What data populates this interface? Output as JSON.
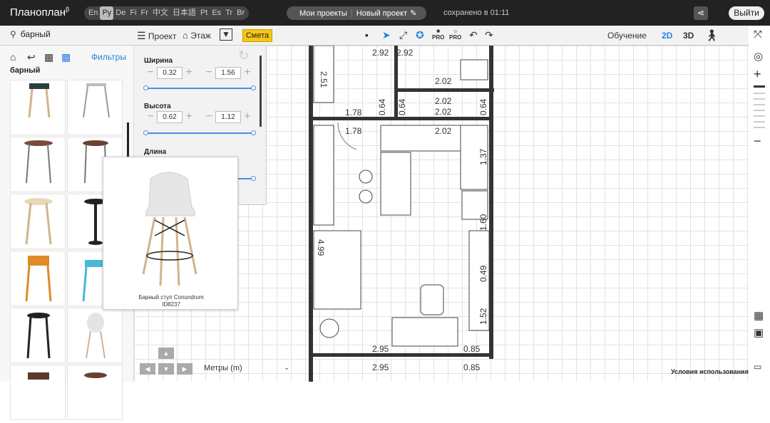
{
  "app": {
    "logo": "Планоплан",
    "logo_sup": "β"
  },
  "languages": [
    "En",
    "Ру",
    "De",
    "Fi",
    "Fr",
    "中文",
    "日本語",
    "Pt",
    "Es",
    "Tr",
    "Br"
  ],
  "projects": {
    "my_projects": "Мои проекты",
    "current": "Новый проект"
  },
  "status": {
    "saved": "сохранено в 01:11"
  },
  "header": {
    "logout": "Выйти"
  },
  "toolbar": {
    "search_value": "барный",
    "project": "Проект",
    "floor": "Этаж",
    "estimate": "Смета",
    "pro1": "PRO",
    "pro2": "PRO",
    "tutorial": "Обучение",
    "view2d": "2D",
    "view3d": "3D"
  },
  "sidebar": {
    "filters": "Фильтры",
    "category": "барный"
  },
  "properties": {
    "width_label": "Ширина",
    "width_a": "0.32",
    "width_b": "1.56",
    "height_label": "Высота",
    "height_a": "0.62",
    "height_b": "1.12",
    "length_label": "Длина"
  },
  "popup": {
    "name": "Барный стул Conundrum",
    "id": "ID8237"
  },
  "plan": {
    "dims": [
      "2.51",
      "2.92",
      "2.92",
      "2.02",
      "0.64",
      "0.64",
      "2.02",
      "2.02",
      "0.64",
      "1.78",
      "1.78",
      "2.02",
      "1.37",
      "1.60",
      "0.49",
      "4.99",
      "1.52",
      "2.95",
      "0.85",
      "2.95",
      "0.85"
    ]
  },
  "footer": {
    "units": "Метры (m)",
    "terms": "Условия использования"
  },
  "colors": {
    "accent": "#2a7fe0",
    "estimate": "#f5c518",
    "topbar": "#222222",
    "wall": "#333333"
  }
}
